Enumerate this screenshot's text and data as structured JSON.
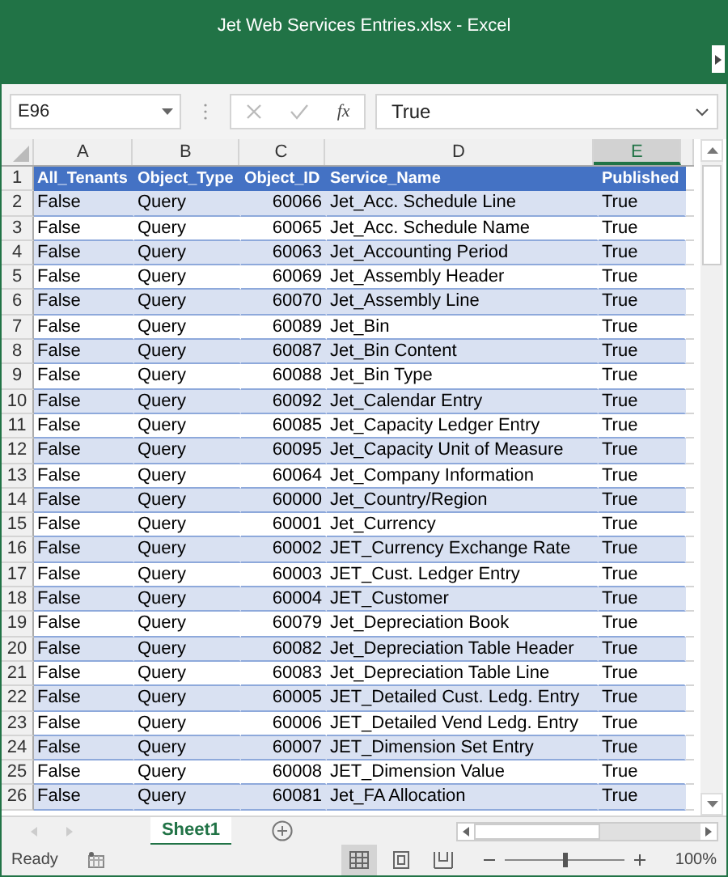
{
  "window": {
    "title": "Jet Web Services Entries.xlsx - Excel"
  },
  "formula_bar": {
    "name_box": "E96",
    "fx": "fx",
    "value": "True"
  },
  "columns": [
    {
      "label": "A",
      "selected": false
    },
    {
      "label": "B",
      "selected": false
    },
    {
      "label": "C",
      "selected": false
    },
    {
      "label": "D",
      "selected": false
    },
    {
      "label": "E",
      "selected": true
    }
  ],
  "rows": [
    {
      "number": "1",
      "kind": "header",
      "cells": [
        "All_Tenants",
        "Object_Type",
        "Object_ID",
        "Service_Name",
        "Published"
      ]
    },
    {
      "number": "2",
      "kind": "data",
      "cells": [
        "False",
        "Query",
        "60066",
        "Jet_Acc. Schedule Line",
        "True"
      ]
    },
    {
      "number": "3",
      "kind": "data",
      "cells": [
        "False",
        "Query",
        "60065",
        "Jet_Acc. Schedule Name",
        "True"
      ]
    },
    {
      "number": "4",
      "kind": "data",
      "cells": [
        "False",
        "Query",
        "60063",
        "Jet_Accounting Period",
        "True"
      ]
    },
    {
      "number": "5",
      "kind": "data",
      "cells": [
        "False",
        "Query",
        "60069",
        "Jet_Assembly Header",
        "True"
      ]
    },
    {
      "number": "6",
      "kind": "data",
      "cells": [
        "False",
        "Query",
        "60070",
        "Jet_Assembly Line",
        "True"
      ]
    },
    {
      "number": "7",
      "kind": "data",
      "cells": [
        "False",
        "Query",
        "60089",
        "Jet_Bin",
        "True"
      ]
    },
    {
      "number": "8",
      "kind": "data",
      "cells": [
        "False",
        "Query",
        "60087",
        "Jet_Bin Content",
        "True"
      ]
    },
    {
      "number": "9",
      "kind": "data",
      "cells": [
        "False",
        "Query",
        "60088",
        "Jet_Bin Type",
        "True"
      ]
    },
    {
      "number": "10",
      "kind": "data",
      "cells": [
        "False",
        "Query",
        "60092",
        "Jet_Calendar Entry",
        "True"
      ]
    },
    {
      "number": "11",
      "kind": "data",
      "cells": [
        "False",
        "Query",
        "60085",
        "Jet_Capacity Ledger Entry",
        "True"
      ]
    },
    {
      "number": "12",
      "kind": "data",
      "cells": [
        "False",
        "Query",
        "60095",
        "Jet_Capacity Unit of Measure",
        "True"
      ]
    },
    {
      "number": "13",
      "kind": "data",
      "cells": [
        "False",
        "Query",
        "60064",
        "Jet_Company Information",
        "True"
      ]
    },
    {
      "number": "14",
      "kind": "data",
      "cells": [
        "False",
        "Query",
        "60000",
        "Jet_Country/Region",
        "True"
      ]
    },
    {
      "number": "15",
      "kind": "data",
      "cells": [
        "False",
        "Query",
        "60001",
        "Jet_Currency",
        "True"
      ]
    },
    {
      "number": "16",
      "kind": "data",
      "cells": [
        "False",
        "Query",
        "60002",
        "JET_Currency Exchange Rate",
        "True"
      ]
    },
    {
      "number": "17",
      "kind": "data",
      "cells": [
        "False",
        "Query",
        "60003",
        "JET_Cust. Ledger Entry",
        "True"
      ]
    },
    {
      "number": "18",
      "kind": "data",
      "cells": [
        "False",
        "Query",
        "60004",
        "JET_Customer",
        "True"
      ]
    },
    {
      "number": "19",
      "kind": "data",
      "cells": [
        "False",
        "Query",
        "60079",
        "Jet_Depreciation Book",
        "True"
      ]
    },
    {
      "number": "20",
      "kind": "data",
      "cells": [
        "False",
        "Query",
        "60082",
        "Jet_Depreciation Table Header",
        "True"
      ]
    },
    {
      "number": "21",
      "kind": "data",
      "cells": [
        "False",
        "Query",
        "60083",
        "Jet_Depreciation Table Line",
        "True"
      ]
    },
    {
      "number": "22",
      "kind": "data",
      "cells": [
        "False",
        "Query",
        "60005",
        "JET_Detailed Cust. Ledg. Entry",
        "True"
      ]
    },
    {
      "number": "23",
      "kind": "data",
      "cells": [
        "False",
        "Query",
        "60006",
        "JET_Detailed Vend Ledg. Entry",
        "True"
      ]
    },
    {
      "number": "24",
      "kind": "data",
      "cells": [
        "False",
        "Query",
        "60007",
        "JET_Dimension Set Entry",
        "True"
      ]
    },
    {
      "number": "25",
      "kind": "data",
      "cells": [
        "False",
        "Query",
        "60008",
        "JET_Dimension Value",
        "True"
      ]
    },
    {
      "number": "26",
      "kind": "data",
      "cells": [
        "False",
        "Query",
        "60081",
        "Jet_FA Allocation",
        "True"
      ]
    }
  ],
  "sheet_tabs": [
    {
      "label": "Sheet1",
      "selected": true
    }
  ],
  "status_bar": {
    "status": "Ready",
    "views": [
      {
        "kind": "normal",
        "selected": true
      },
      {
        "kind": "page_layout",
        "selected": false
      },
      {
        "kind": "page_break",
        "selected": false
      }
    ],
    "zoom": {
      "level": 0.5,
      "reading": "100%"
    }
  }
}
